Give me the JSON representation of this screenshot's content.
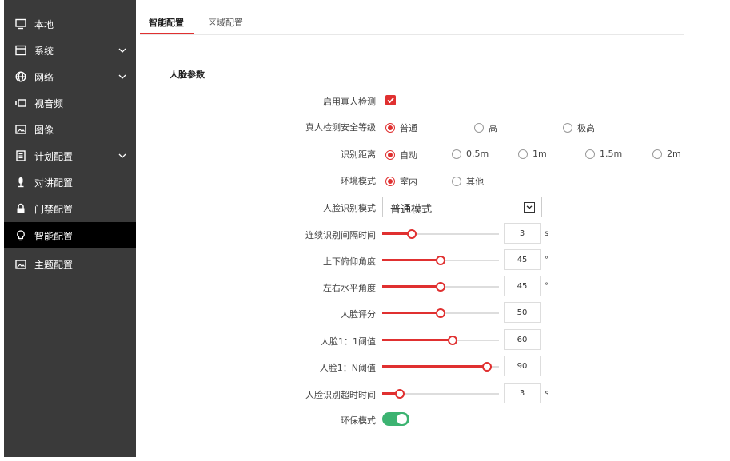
{
  "sidebar": {
    "items": [
      {
        "label": "本地",
        "icon": "monitor-icon",
        "expandable": false
      },
      {
        "label": "系统",
        "icon": "window-icon",
        "expandable": true
      },
      {
        "label": "网络",
        "icon": "globe-icon",
        "expandable": true
      },
      {
        "label": "视音频",
        "icon": "video-icon",
        "expandable": false
      },
      {
        "label": "图像",
        "icon": "image-icon",
        "expandable": false
      },
      {
        "label": "计划配置",
        "icon": "schedule-icon",
        "expandable": true
      },
      {
        "label": "对讲配置",
        "icon": "microphone-icon",
        "expandable": false
      },
      {
        "label": "门禁配置",
        "icon": "lock-icon",
        "expandable": false
      },
      {
        "label": "智能配置",
        "icon": "lightbulb-icon",
        "expandable": false,
        "active": true
      },
      {
        "label": "主题配置",
        "icon": "theme-icon",
        "expandable": false
      }
    ]
  },
  "tabs": [
    {
      "label": "智能配置",
      "active": true
    },
    {
      "label": "区域配置",
      "active": false
    }
  ],
  "section": {
    "title": "人脸参数"
  },
  "form": {
    "liveness": {
      "label": "启用真人检测",
      "checked": true
    },
    "security_level": {
      "label": "真人检测安全等级",
      "options": [
        "普通",
        "高",
        "极高"
      ],
      "selected": "普通"
    },
    "distance": {
      "label": "识别距离",
      "options": [
        "自动",
        "0.5m",
        "1m",
        "1.5m",
        "2m"
      ],
      "selected": "自动"
    },
    "environment": {
      "label": "环境模式",
      "options": [
        "室内",
        "其他"
      ],
      "selected": "室内"
    },
    "face_mode": {
      "label": "人脸识别模式",
      "value": "普通模式"
    },
    "sliders": [
      {
        "label": "连续识别间隔时间",
        "value": "3",
        "unit": "s",
        "fraction": 0.25
      },
      {
        "label": "上下俯仰角度",
        "value": "45",
        "unit": "°",
        "fraction": 0.5
      },
      {
        "label": "左右水平角度",
        "value": "45",
        "unit": "°",
        "fraction": 0.5
      },
      {
        "label": "人脸评分",
        "value": "50",
        "unit": "",
        "fraction": 0.5
      },
      {
        "label": "人脸1：1阈值",
        "value": "60",
        "unit": "",
        "fraction": 0.6
      },
      {
        "label": "人脸1：N阈值",
        "value": "90",
        "unit": "",
        "fraction": 0.9
      },
      {
        "label": "人脸识别超时时间",
        "value": "3",
        "unit": "s",
        "fraction": 0.15
      }
    ],
    "eco_mode": {
      "label": "环保模式",
      "on": true
    }
  },
  "colors": {
    "accent": "#e03030",
    "sidebar_bg": "#3a3a3a",
    "sidebar_active": "#000000",
    "toggle_on": "#3cb371"
  }
}
